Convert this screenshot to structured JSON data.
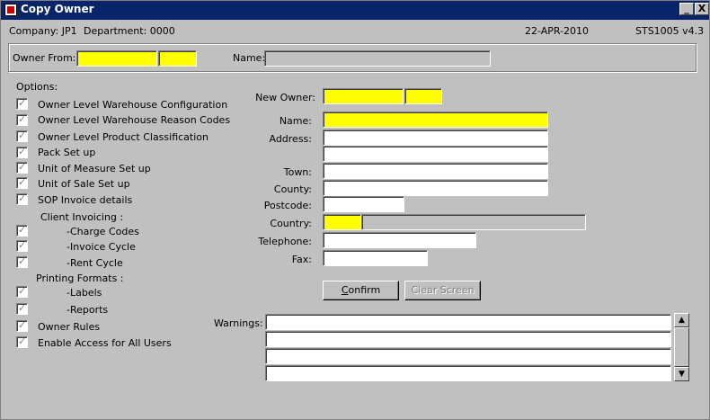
{
  "window": {
    "title": "Copy Owner",
    "minimize_glyph": "_",
    "close_glyph": "X"
  },
  "header": {
    "company": "Company: JP1",
    "department": "Department: 0000",
    "date": "22-APR-2010",
    "version": "STS1005  v4.3"
  },
  "owner_from": {
    "label": "Owner From:",
    "code1": "",
    "code2": "",
    "name_label": "Name:",
    "name": ""
  },
  "options": {
    "title": "Options:",
    "items": [
      {
        "label": "Owner Level Warehouse Configuration",
        "checked": true
      },
      {
        "label": "Owner Level Warehouse Reason Codes",
        "checked": true
      },
      {
        "label": "Owner Level Product Classification",
        "checked": true
      },
      {
        "label": "Pack Set up",
        "checked": true
      },
      {
        "label": "Unit of Measure Set up",
        "checked": true
      },
      {
        "label": "Unit of Sale Set up",
        "checked": true
      },
      {
        "label": "SOP Invoice details",
        "checked": true
      }
    ],
    "client_invoicing_label": "Client Invoicing :",
    "client_invoicing": [
      {
        "label": "-Charge Codes",
        "checked": true
      },
      {
        "label": "-Invoice Cycle",
        "checked": true
      },
      {
        "label": "-Rent Cycle",
        "checked": true
      }
    ],
    "printing_formats_label": "Printing Formats :",
    "printing_formats": [
      {
        "label": "-Labels",
        "checked": true
      },
      {
        "label": "-Reports",
        "checked": true
      }
    ],
    "owner_rules": {
      "label": "Owner Rules",
      "checked": true
    },
    "enable_access": {
      "label": "Enable Access for All Users",
      "checked": true
    }
  },
  "new_owner": {
    "new_owner_label": "New Owner:",
    "name_label": "Name:",
    "address_label": "Address:",
    "town_label": "Town:",
    "county_label": "County:",
    "postcode_label": "Postcode:",
    "country_label": "Country:",
    "telephone_label": "Telephone:",
    "fax_label": "Fax:"
  },
  "buttons": {
    "confirm_prefix": "C",
    "confirm_rest": "onfirm",
    "clear": "Clear Screen"
  },
  "warnings": {
    "label": "Warnings:",
    "up_glyph": "▲",
    "down_glyph": "▼"
  }
}
